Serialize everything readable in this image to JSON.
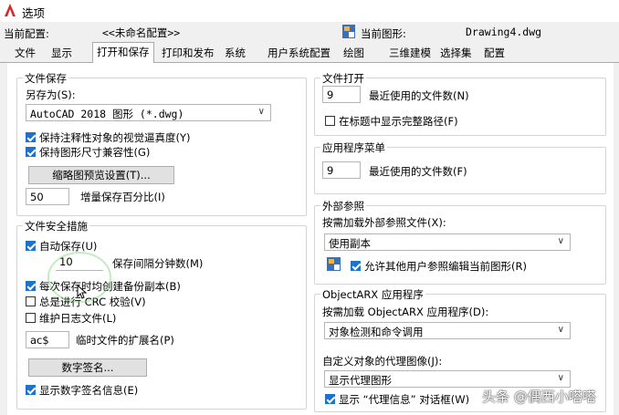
{
  "window": {
    "title": "选项"
  },
  "header": {
    "profile_label": "当前配置:",
    "profile_value": "<<未命名配置>>",
    "drawing_label": "当前图形:",
    "drawing_value": "Drawing4.dwg"
  },
  "tabs": [
    "文件",
    "显示",
    "打开和保存",
    "打印和发布",
    "系统",
    "用户系统配置",
    "绘图",
    "三维建模",
    "选择集",
    "配置"
  ],
  "active_tab": "打开和保存",
  "file_save": {
    "title": "文件保存",
    "save_as_label": "另存为(S):",
    "save_as_value": "AutoCAD 2018 图形 (*.dwg)",
    "keep_visual_fidelity": {
      "label": "保持注释性对象的视觉逼真度(Y)",
      "checked": true
    },
    "keep_drawing_size": {
      "label": "保持图形尺寸兼容性(G)",
      "checked": true
    },
    "thumbnail_button": "缩略图预览设置(T)...",
    "incremental_value": "50",
    "incremental_label": "增量保存百分比(I)"
  },
  "file_safety": {
    "title": "文件安全措施",
    "autosave": {
      "label": "自动保存(U)",
      "checked": true
    },
    "interval_value": "10",
    "interval_label": "保存间隔分钟数(M)",
    "backup": {
      "label": "每次保存时均创建备份副本(B)",
      "checked": true
    },
    "crc": {
      "label": "总是进行 CRC 校验(V)",
      "checked": false
    },
    "log": {
      "label": "维护日志文件(L)",
      "checked": false
    },
    "temp_ext_value": "ac$",
    "temp_ext_label": "临时文件的扩展名(P)",
    "signature_button": "数字签名...",
    "show_signature": {
      "label": "显示数字签名信息(E)",
      "checked": true
    }
  },
  "file_open": {
    "title": "文件打开",
    "recent_value": "9",
    "recent_label": "最近使用的文件数(N)",
    "full_path": {
      "label": "在标题中显示完整路径(F)",
      "checked": false
    }
  },
  "app_menu": {
    "title": "应用程序菜单",
    "recent_value": "9",
    "recent_label": "最近使用的文件数(F)"
  },
  "xref": {
    "title": "外部参照",
    "demand_load_label": "按需加载外部参照文件(X):",
    "demand_load_value": "使用副本",
    "allow_edit": {
      "label": "允许其他用户参照编辑当前图形(R)",
      "checked": true
    }
  },
  "objectarx": {
    "title": "ObjectARX 应用程序",
    "demand_load_label": "按需加载 ObjectARX 应用程序(D):",
    "demand_load_value": "对象检测和命令调用",
    "proxy_label": "自定义对象的代理图像(J):",
    "proxy_value": "显示代理图形",
    "show_proxy": {
      "label": "显示 “代理信息” 对话框(W)",
      "checked": true
    }
  },
  "watermark": "头条 @偶西小嗒嗒",
  "colors": {
    "accent": "#1e72c8",
    "logo": "#d9262b"
  }
}
